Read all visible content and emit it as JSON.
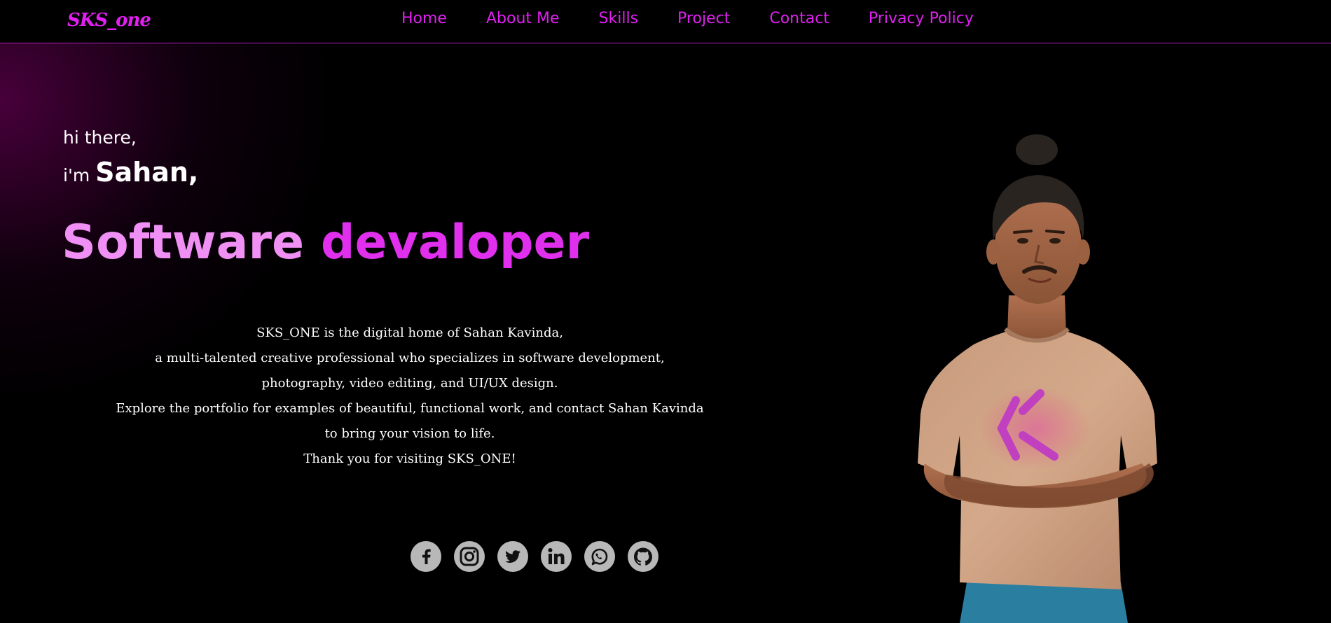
{
  "nav": {
    "logo": "SKS_one",
    "links": [
      "Home",
      "About Me",
      "Skills",
      "Project",
      "Contact",
      "Privacy Policy"
    ]
  },
  "hero": {
    "greeting": "hi there,",
    "intro_prefix": "i'm ",
    "name": "Sahan,",
    "role_word1": "Software",
    "role_word2": "devaloper",
    "description": [
      "SKS_ONE is the digital home of Sahan Kavinda,",
      "a multi-talented creative professional who specializes in software development,",
      "photography, video editing, and UI/UX design.",
      "Explore the portfolio for examples of beautiful, functional work, and contact Sahan Kavinda to bring your vision to life.",
      "Thank you for visiting SKS_ONE!"
    ]
  },
  "socials": [
    {
      "icon": "facebook-icon"
    },
    {
      "icon": "instagram-icon"
    },
    {
      "icon": "twitter-icon"
    },
    {
      "icon": "linkedin-icon"
    },
    {
      "icon": "whatsapp-icon"
    },
    {
      "icon": "github-icon"
    }
  ],
  "colors": {
    "accent": "#e020f0",
    "accent_light": "#f090f4",
    "background": "#000000",
    "social_bg": "#b8b8b8"
  }
}
